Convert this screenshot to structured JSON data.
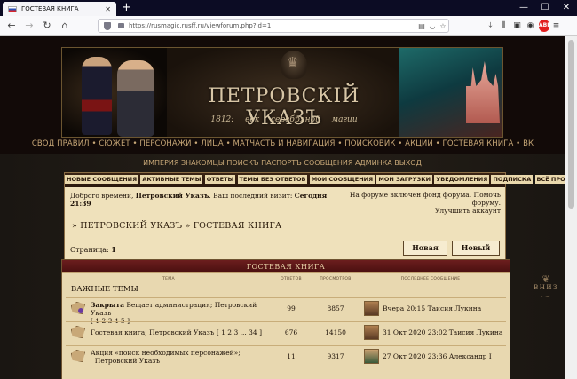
{
  "browser": {
    "tab_title": "ГОСТЕВАЯ КНИГА",
    "tab_close": "✕",
    "new_tab": "+",
    "win_minimize": "—",
    "win_maximize": "☐",
    "win_close": "✕",
    "url": "https://rusmagic.rusff.ru/viewforum.php?id=1"
  },
  "banner": {
    "name": "ПЕТРОВСКIЙ УКАЗЪ",
    "subtitle": "1812: век серебряной магии"
  },
  "main_nav": "СВОД ПРАВИЛ • СЮЖЕТ • ПЕРСОНАЖИ • ЛИЦА • МАТЧАСТЬ И НАВИГАЦИЯ • ПОИСКОВИК • АКЦИИ • ГОСТЕВАЯ КНИГА • ВК",
  "sub_nav": "ИМПЕРИЯ   ЗНАКОМЦЫ   ПОИСКЪ   ПАСПОРТЪ   СООБЩЕНИЯ   АДМИНКА   ВЫХОД",
  "top_links": [
    "НОВЫЕ СООБЩЕНИЯ",
    "АКТИВНЫЕ ТЕМЫ",
    "ОТВЕТЫ",
    "ТЕМЫ БЕЗ ОТВЕТОВ",
    "МОИ СООБЩЕНИЯ",
    "МОИ ЗАГРУЗКИ",
    "УВЕДОМЛЕНИЯ",
    "ПОДПИСКА",
    "ВСЁ ПРОЧИТАНО"
  ],
  "welcome": {
    "greeting": "Доброго времени,",
    "user": "Петровский Указъ",
    "last_visit_label": ". Ваш последний визит:",
    "last_visit": "Сегодня 21:39"
  },
  "notice": {
    "line1": "На форуме включен фонд форума. Помочь форуму.",
    "line2": "Улучшить аккаунт"
  },
  "breadcrumb": "» ПЕТРОВСКИЙ УКАЗЪ » ГОСТЕВАЯ КНИГА",
  "pages": {
    "label": "Страница:",
    "current": "1"
  },
  "buttons": {
    "new_topic": "Новая тема",
    "new_poll": "Новый опрос"
  },
  "section": {
    "title": "ГОСТЕВАЯ КНИГА",
    "col_topic": "ТЕМА",
    "col_replies": "ОТВЕТОВ",
    "col_views": "ПРОСМОТРОВ",
    "col_last": "ПОСЛЕДНЕЕ СООБЩЕНИЕ",
    "important": "ВАЖНЫЕ ТЕМЫ"
  },
  "topics": [
    {
      "prefix": "Закрыта",
      "title": " Вещает администрация;  Петровский Указъ",
      "pages": "[ 1 2 3 4 5 ]",
      "replies": "99",
      "views": "8857",
      "last": "Вчера 20:15  Таисия Лукина"
    },
    {
      "prefix": "",
      "title": "Гостевая книга;  Петровский Указъ  [ 1 2 3 ... 34 ]",
      "pages": "",
      "replies": "676",
      "views": "14150",
      "last": "31 Окт 2020 23:02  Таисия Лукина"
    },
    {
      "prefix": "",
      "title": "Акция «поиск необходимых персонажей»;",
      "pages": "Петровский Указъ",
      "replies": "11",
      "views": "9317",
      "last": "27 Окт 2020 23:36  Александр I"
    }
  ],
  "side_label": "ВНИЗ"
}
